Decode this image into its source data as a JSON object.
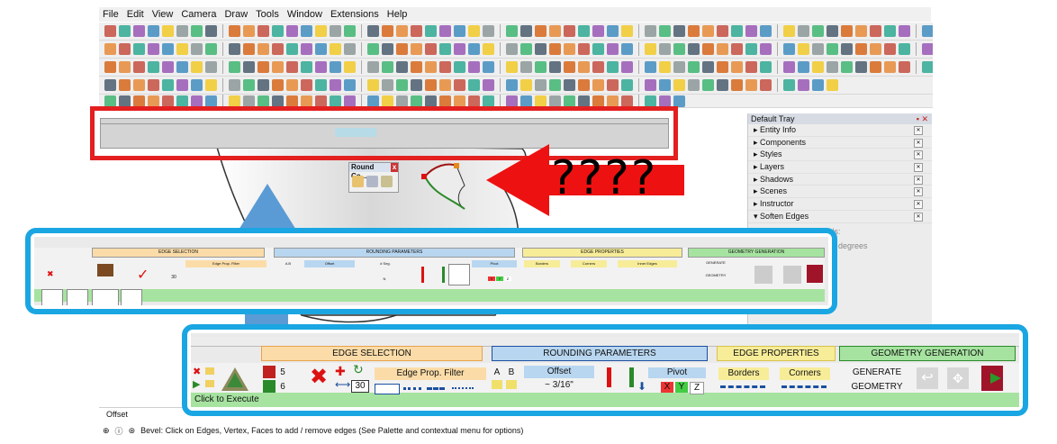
{
  "menu": [
    "File",
    "Edit",
    "View",
    "Camera",
    "Draw",
    "Tools",
    "Window",
    "Extensions",
    "Help"
  ],
  "tray": {
    "title": "Default Tray",
    "items": [
      "Entity Info",
      "Components",
      "Styles",
      "Layers",
      "Shadows",
      "Scenes",
      "Instructor",
      "Soften Edges"
    ],
    "soften_caption": "Angle between normals:",
    "degrees": "degrees"
  },
  "rc_dialog_title": "Round Co...",
  "question": "????",
  "status_text": "Bevel: Click on Edges, Vertex, Faces to add / remove edges (See Palette and contextual menu for options)",
  "vcb_label": "Offset",
  "small_palette": {
    "edge_selection": "EDGE SELECTION",
    "rounding_parameters": "ROUNDING PARAMETERS",
    "edge_properties": "EDGE PROPERTIES",
    "geometry_generation": "GEOMETRY GENERATION",
    "edge_prop_filter": "Edge Prop. Filter",
    "ab": "A   B",
    "offset": "Offset",
    "seg": "# Seg.",
    "pivot": "Pivot",
    "borders": "Borders",
    "corners": "Corners",
    "inner_edges": "Inner Edges",
    "generate": "GENERATE",
    "geometry": "GEOMETRY",
    "seg_val": "30",
    "seg_n": "N",
    "x": "X",
    "y": "Y",
    "z": "Z"
  },
  "palette": {
    "edge_selection": "EDGE SELECTION",
    "rounding_parameters": "ROUNDING PARAMETERS",
    "edge_properties": "EDGE PROPERTIES",
    "geometry_generation": "GEOMETRY GENERATION",
    "seg5": "5",
    "seg6": "6",
    "seg30": "30",
    "edge_prop_filter": "Edge Prop. Filter",
    "a": "A",
    "b": "B",
    "offset": "Offset",
    "offset_value": "~ 3/16\"",
    "pivot": "Pivot",
    "x": "X",
    "y": "Y",
    "z": "Z",
    "borders": "Borders",
    "corners": "Corners",
    "generate": "GENERATE",
    "geometry": "GEOMETRY",
    "click_to_execute": "Click to Execute"
  }
}
